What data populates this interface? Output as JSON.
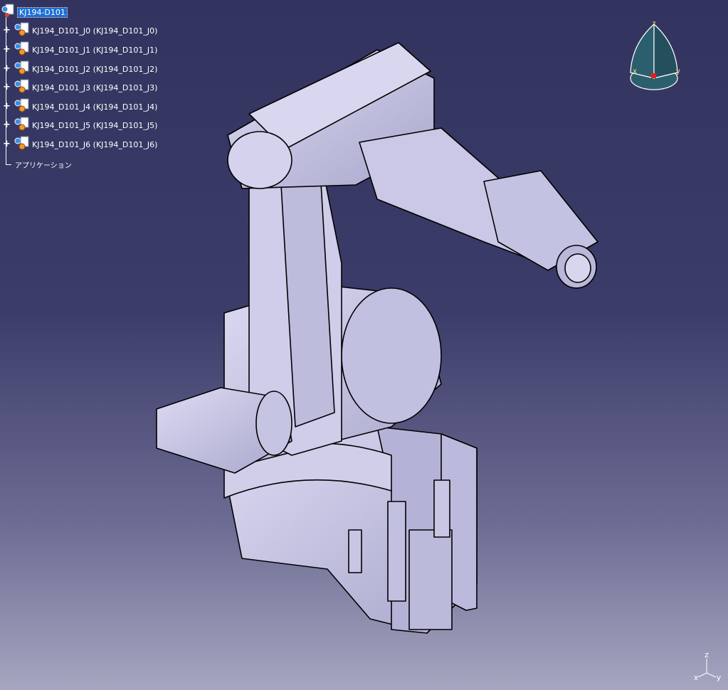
{
  "tree": {
    "root": {
      "label": "KJ194-D101",
      "icon": "product-icon"
    },
    "children": [
      {
        "label": "KJ194_D101_J0 (KJ194_D101_J0)",
        "icon": "part-icon"
      },
      {
        "label": "KJ194_D101_J1 (KJ194_D101_J1)",
        "icon": "part-icon"
      },
      {
        "label": "KJ194_D101_J2 (KJ194_D101_J2)",
        "icon": "part-icon"
      },
      {
        "label": "KJ194_D101_J3 (KJ194_D101_J3)",
        "icon": "part-icon"
      },
      {
        "label": "KJ194_D101_J4 (KJ194_D101_J4)",
        "icon": "part-icon"
      },
      {
        "label": "KJ194_D101_J5 (KJ194_D101_J5)",
        "icon": "part-icon"
      },
      {
        "label": "KJ194_D101_J6 (KJ194_D101_J6)",
        "icon": "part-icon"
      }
    ],
    "applications_label": "アプリケーション"
  },
  "compass": {
    "labels": {
      "z": "z",
      "x": "x",
      "y": "y"
    }
  },
  "triad": {
    "labels": {
      "z": "z",
      "x": "x",
      "y": "y"
    }
  },
  "colors": {
    "background_top": "#33335f",
    "background_bottom": "#a6a6c0",
    "model_fill": "#c9c7e6",
    "model_edge": "#000000",
    "selection": "#1c6fd6",
    "compass_fill": "#2b5f6e"
  }
}
